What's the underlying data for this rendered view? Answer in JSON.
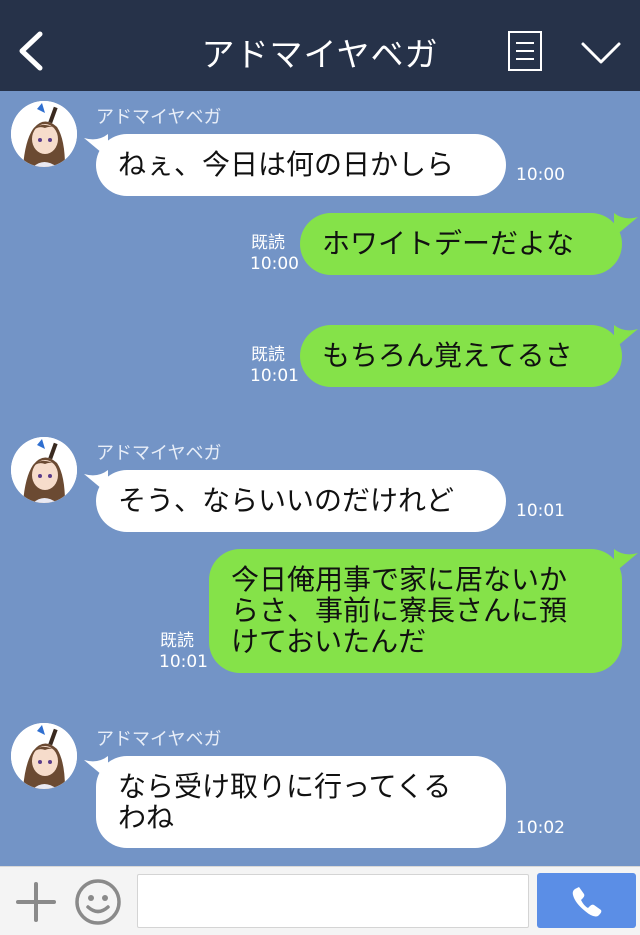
{
  "header": {
    "title": "アドマイヤベガ"
  },
  "messages": [
    {
      "side": "in",
      "sender": "アドマイヤベガ",
      "text": "ねぇ、今日は何の日かしら",
      "time": "10:00"
    },
    {
      "side": "out",
      "read": "既読",
      "text": "ホワイトデーだよな",
      "time": "10:00"
    },
    {
      "side": "out",
      "read": "既読",
      "text": "もちろん覚えてるさ",
      "time": "10:01"
    },
    {
      "side": "in",
      "sender": "アドマイヤベガ",
      "text": "そう、ならいいのだけれど",
      "time": "10:01"
    },
    {
      "side": "out",
      "read": "既読",
      "lines": [
        "今日俺用事で家に居ないか",
        "らさ、事前に寮長さんに預",
        "けておいたんだ"
      ],
      "time": "10:01"
    },
    {
      "side": "in",
      "sender": "アドマイヤベガ",
      "lines": [
        "なら受け取りに行ってくる",
        "わね"
      ],
      "time": "10:02"
    }
  ],
  "input": {
    "placeholder": ""
  },
  "colors": {
    "header": "#263249",
    "background": "#7394c6",
    "outgoing_bubble": "#85e249",
    "incoming_bubble": "#ffffff",
    "call_button": "#5b8ee6"
  },
  "icons": [
    "back-icon",
    "menu-icon",
    "chevron-down-icon",
    "plus-icon",
    "smile-icon",
    "phone-icon"
  ]
}
